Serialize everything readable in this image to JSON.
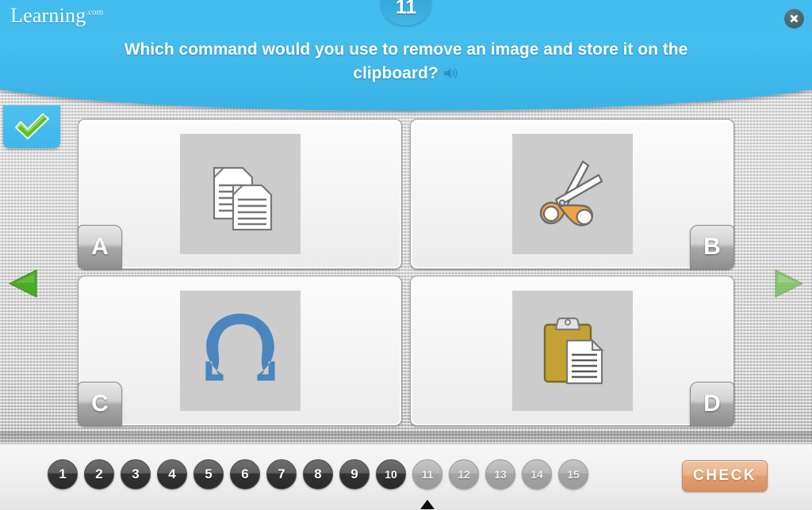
{
  "header": {
    "logo_text": "Learning",
    "logo_suffix": ".com",
    "question_number": "11",
    "question_text": "Which command would you use to remove an image and store it on the clipboard?",
    "speaker_icon": "speaker-audio-icon",
    "close_icon": "close-x-icon",
    "background_color": "#41bdee"
  },
  "status": {
    "checkmark_icon": "green-checkmark-icon",
    "checkmark_color": "#4caf20"
  },
  "navigation": {
    "prev_icon": "triangle-left-icon",
    "next_icon": "triangle-right-icon",
    "prev_enabled": true,
    "next_enabled": false,
    "arrow_color": "#4ca82a"
  },
  "answers": [
    {
      "letter": "A",
      "letter_position": "left",
      "icon": "copy-documents-icon",
      "icon_label": "Copy",
      "selected": false
    },
    {
      "letter": "B",
      "letter_position": "right",
      "icon": "scissors-cut-icon",
      "icon_label": "Cut",
      "selected": false
    },
    {
      "letter": "C",
      "letter_position": "left",
      "icon": "omega-symbol-icon",
      "icon_label": "Symbol",
      "selected": false
    },
    {
      "letter": "D",
      "letter_position": "right",
      "icon": "clipboard-paste-icon",
      "icon_label": "Paste",
      "selected": false
    }
  ],
  "pager": {
    "items": [
      {
        "label": "1",
        "state": "done"
      },
      {
        "label": "2",
        "state": "done"
      },
      {
        "label": "3",
        "state": "done"
      },
      {
        "label": "4",
        "state": "done"
      },
      {
        "label": "5",
        "state": "done"
      },
      {
        "label": "6",
        "state": "done"
      },
      {
        "label": "7",
        "state": "done"
      },
      {
        "label": "8",
        "state": "done"
      },
      {
        "label": "9",
        "state": "done"
      },
      {
        "label": "10",
        "state": "done"
      },
      {
        "label": "11",
        "state": "todo",
        "current": true
      },
      {
        "label": "12",
        "state": "todo"
      },
      {
        "label": "13",
        "state": "todo"
      },
      {
        "label": "14",
        "state": "todo"
      },
      {
        "label": "15",
        "state": "todo"
      }
    ],
    "check_label": "CHECK",
    "check_color": "#e5a878"
  }
}
